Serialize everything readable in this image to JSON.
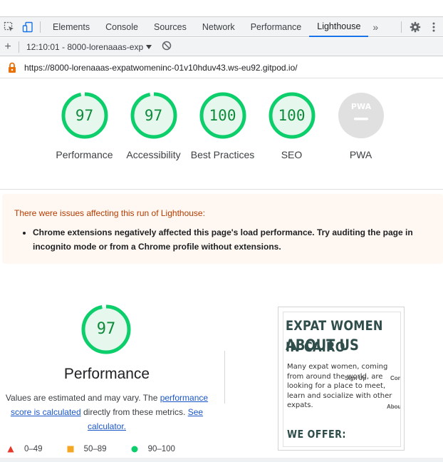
{
  "devtools": {
    "tabs": [
      {
        "label": "Elements"
      },
      {
        "label": "Console"
      },
      {
        "label": "Sources"
      },
      {
        "label": "Network"
      },
      {
        "label": "Performance"
      },
      {
        "label": "Lighthouse",
        "active": true
      }
    ],
    "more_label": "»"
  },
  "report_bar": {
    "selected_report": "12:10:01 - 8000-lorenaaas-exp"
  },
  "url": "https://8000-lorenaaas-expatwomeninc-01v10hduv43.ws-eu92.gitpod.io/",
  "gauges": [
    {
      "score": "97",
      "value": 97,
      "label": "Performance"
    },
    {
      "score": "97",
      "value": 97,
      "label": "Accessibility"
    },
    {
      "score": "100",
      "value": 100,
      "label": "Best Practices"
    },
    {
      "score": "100",
      "value": 100,
      "label": "SEO"
    },
    {
      "score": "",
      "value": null,
      "label": "PWA",
      "pwa_badge": "PWA"
    }
  ],
  "warning": {
    "title": "There were issues affecting this run of Lighthouse:",
    "items": [
      "Chrome extensions negatively affected this page's load performance. Try auditing the page in incognito mode or from a Chrome profile without extensions."
    ]
  },
  "performance": {
    "score": "97",
    "value": 97,
    "title": "Performance",
    "desc_prefix": "Values are estimated and may vary. The ",
    "desc_link1": "performance score is calculated",
    "desc_middle": " directly from these metrics. ",
    "desc_link2": "See calculator."
  },
  "legend": [
    {
      "range": "0–49",
      "color": "#e8372a",
      "shape": "triangle"
    },
    {
      "range": "50–89",
      "color": "#f5a623",
      "shape": "square"
    },
    {
      "range": "90–100",
      "color": "#0cce6b",
      "shape": "circle"
    }
  ],
  "screenshot": {
    "heading1": "EXPAT WOMEN IN CAIRO",
    "heading2": "ABOUT US",
    "paragraph": "Many expat women, coming from around the world, are looking for a place to meet, learn and socialize with other expats.",
    "nav_sign_up": "Sign Up",
    "nav_cont": "Cont",
    "nav_about": "About",
    "heading3": "WE OFFER:"
  },
  "colors": {
    "pass": "#0cce6b",
    "pass_text": "#0d8a3a",
    "pass_bg": "#e6f8ee",
    "accent": "#1a73e8"
  }
}
